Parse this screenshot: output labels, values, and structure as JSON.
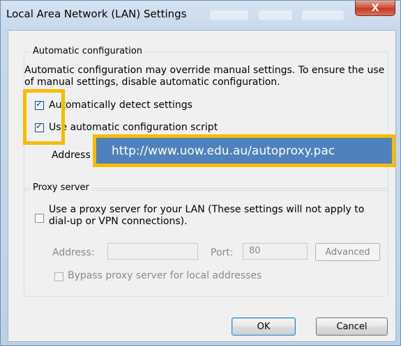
{
  "window": {
    "title": "Local Area Network (LAN) Settings",
    "close_label": "X"
  },
  "auto_config": {
    "group_label": "Automatic configuration",
    "description": "Automatic configuration may override manual settings.  To ensure the use of manual settings, disable automatic configuration.",
    "detect_label": "Automatically detect settings",
    "detect_checked": true,
    "script_label": "Use automatic configuration script",
    "script_checked": true,
    "address_label": "Address",
    "address_value": "http://www.uow.edu.au/autoproxy.pac"
  },
  "proxy": {
    "group_label": "Proxy server",
    "use_proxy_label": "Use a proxy server for your LAN (These settings will not apply to dial-up or VPN connections).",
    "use_proxy_checked": false,
    "address_label": "Address:",
    "address_value": "",
    "port_label": "Port:",
    "port_value": "80",
    "advanced_label": "Advanced",
    "bypass_label": "Bypass proxy server for local addresses",
    "bypass_checked": false
  },
  "buttons": {
    "ok_label": "OK",
    "cancel_label": "Cancel"
  },
  "colors": {
    "highlight_border": "#f9bb00",
    "url_banner_bg": "#4f81bd",
    "close_button": "#c43a24"
  }
}
